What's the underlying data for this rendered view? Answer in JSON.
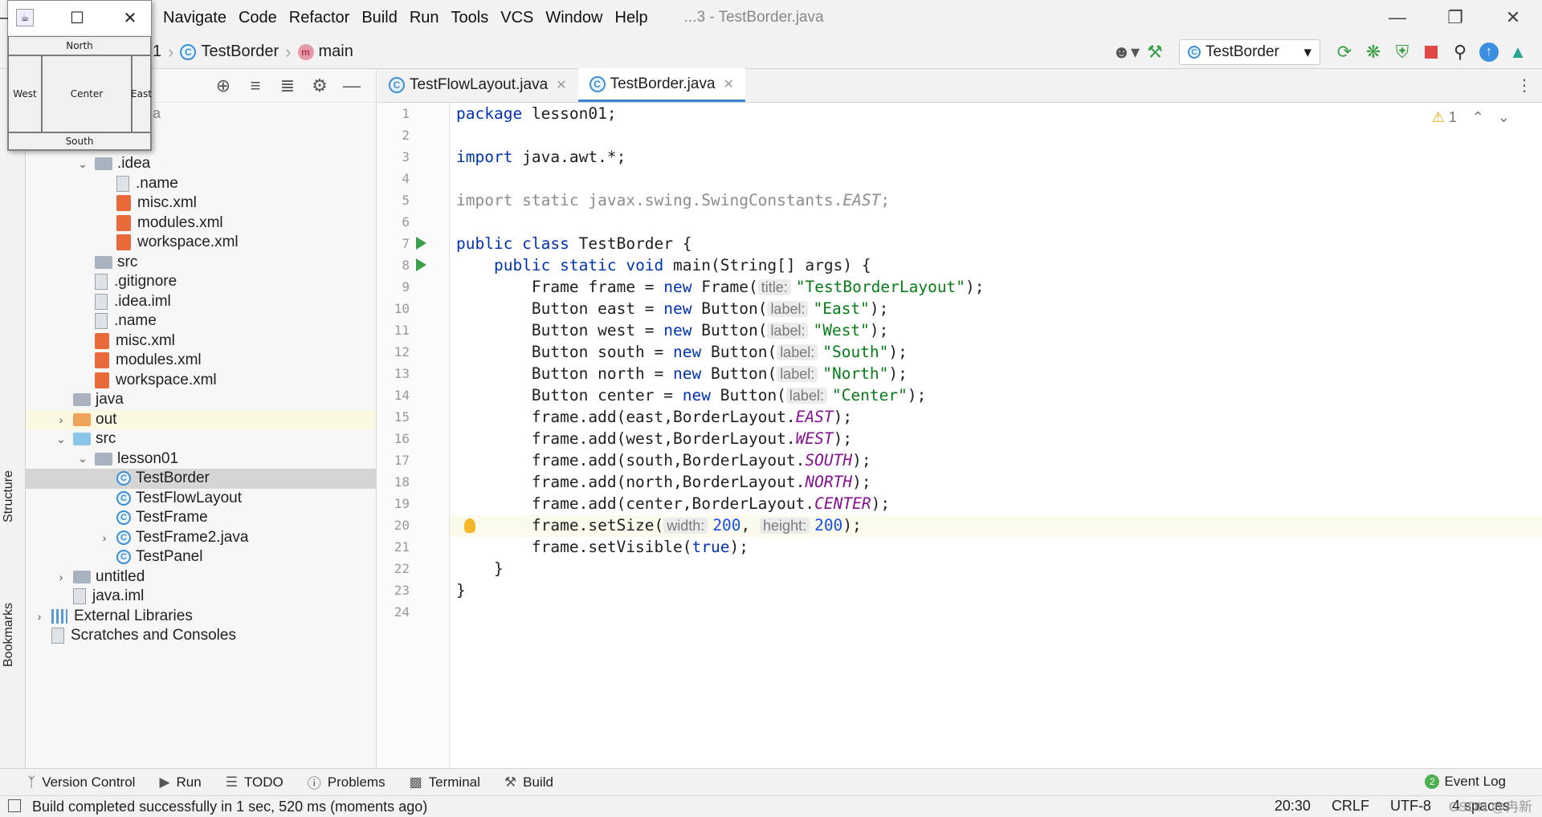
{
  "menu": {
    "items": [
      "Navigate",
      "Code",
      "Refactor",
      "Build",
      "Run",
      "Tools",
      "VCS",
      "Window",
      "Help"
    ],
    "title": "...3 - TestBorder.java"
  },
  "breadcrumb": {
    "root_fragment": "1",
    "class_name": "TestBorder",
    "method_name": "main"
  },
  "run_config": "TestBorder",
  "editor_tabs": [
    {
      "label": "TestFlowLayout.java"
    },
    {
      "label": "TestBorder.java"
    }
  ],
  "project_tree": [
    {
      "label": ".idea",
      "indent": 2,
      "icon": "folder",
      "arrow": "v"
    },
    {
      "label": ".name",
      "indent": 3,
      "icon": "file"
    },
    {
      "label": "misc.xml",
      "indent": 3,
      "icon": "xml"
    },
    {
      "label": "modules.xml",
      "indent": 3,
      "icon": "xml"
    },
    {
      "label": "workspace.xml",
      "indent": 3,
      "icon": "xml"
    },
    {
      "label": "src",
      "indent": 2,
      "icon": "folder"
    },
    {
      "label": ".gitignore",
      "indent": 2,
      "icon": "file"
    },
    {
      "label": ".idea.iml",
      "indent": 2,
      "icon": "file"
    },
    {
      "label": ".name",
      "indent": 2,
      "icon": "file"
    },
    {
      "label": "misc.xml",
      "indent": 2,
      "icon": "xml"
    },
    {
      "label": "modules.xml",
      "indent": 2,
      "icon": "xml"
    },
    {
      "label": "workspace.xml",
      "indent": 2,
      "icon": "xml"
    },
    {
      "label": "java",
      "indent": 1,
      "icon": "folder"
    },
    {
      "label": "out",
      "indent": 1,
      "icon": "folder-orange",
      "arrow": ">",
      "highlight": true
    },
    {
      "label": "src",
      "indent": 1,
      "icon": "folder-blue",
      "arrow": "v"
    },
    {
      "label": "lesson01",
      "indent": 2,
      "icon": "folder",
      "arrow": "v"
    },
    {
      "label": "TestBorder",
      "indent": 3,
      "icon": "class",
      "selected": true
    },
    {
      "label": "TestFlowLayout",
      "indent": 3,
      "icon": "class"
    },
    {
      "label": "TestFrame",
      "indent": 3,
      "icon": "class"
    },
    {
      "label": "TestFrame2.java",
      "indent": 3,
      "icon": "class",
      "arrow": ">"
    },
    {
      "label": "TestPanel",
      "indent": 3,
      "icon": "class"
    },
    {
      "label": "untitled",
      "indent": 1,
      "icon": "folder",
      "arrow": ">"
    },
    {
      "label": "java.iml",
      "indent": 1,
      "icon": "file"
    },
    {
      "label": "External Libraries",
      "indent": 0,
      "icon": "lib",
      "arrow": ">"
    },
    {
      "label": "Scratches and Consoles",
      "indent": 0,
      "icon": "scratch"
    }
  ],
  "project_partial_label": "a",
  "side_labels": {
    "structure": "Structure",
    "bookmarks": "Bookmarks"
  },
  "code_lines": [
    "<span class=\"kw\">package</span> lesson01;",
    "",
    "<span class=\"kw\">import</span> java.awt.*;",
    "",
    "<span class=\"gray\">import static javax.swing.SwingConstants.<i>EAST</i>;</span>",
    "",
    "<span class=\"kw\">public class</span> TestBorder {",
    "    <span class=\"kw\">public static void</span> main(String[] args) {",
    "        Frame frame = <span class=\"kw\">new</span> Frame(<span class=\"hint\">title:</span><span class=\"str\">\"TestBorderLayout\"</span>);",
    "        Button east = <span class=\"kw\">new</span> Button(<span class=\"hint\">label:</span><span class=\"str\">\"East\"</span>);",
    "        Button west = <span class=\"kw\">new</span> Button(<span class=\"hint\">label:</span><span class=\"str\">\"West\"</span>);",
    "        Button south = <span class=\"kw\">new</span> Button(<span class=\"hint\">label:</span><span class=\"str\">\"South\"</span>);",
    "        Button north = <span class=\"kw\">new</span> Button(<span class=\"hint\">label:</span><span class=\"str\">\"North\"</span>);",
    "        Button center = <span class=\"kw\">new</span> Button(<span class=\"hint\">label:</span><span class=\"str\">\"Center\"</span>);",
    "        frame.add(east,BorderLayout.<span class=\"it\">EAST</span>);",
    "        frame.add(west,BorderLayout.<span class=\"it\">WEST</span>);",
    "        frame.add(south,BorderLayout.<span class=\"it\">SOUTH</span>);",
    "        frame.add(north,BorderLayout.<span class=\"it\">NORTH</span>);",
    "        frame.add(center,BorderLayout.<span class=\"it\">CENTER</span>);",
    "        frame.setSize(<span class=\"hint\">width:</span><span class=\"num\">200</span>, <span class=\"hint\">height:</span><span class=\"num\">200</span>);",
    "        frame.setVisible(<span class=\"kw\">true</span>);",
    "    }",
    "}",
    ""
  ],
  "current_line": 20,
  "warning_count": "1",
  "bottom_tools": [
    "Version Control",
    "Run",
    "TODO",
    "Problems",
    "Terminal",
    "Build"
  ],
  "event_log": {
    "label": "Event Log",
    "count": "2"
  },
  "status": {
    "message": "Build completed successfully in 1 sec, 520 ms (moments ago)",
    "position": "20:30",
    "line_sep": "CRLF",
    "encoding": "UTF-8",
    "indent": "4 spaces"
  },
  "watermark": "CSDN @冉新",
  "awt_frame": {
    "buttons": {
      "north": "North",
      "west": "West",
      "center": "Center",
      "east": "East",
      "south": "South"
    }
  }
}
